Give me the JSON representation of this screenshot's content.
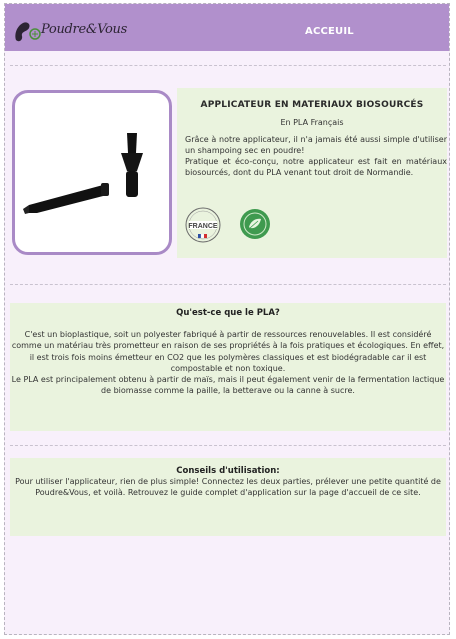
{
  "header": {
    "logo_text": "Poudre&Vous",
    "nav_link": "ACCEUIL",
    "colors": {
      "bar": "#b190cc",
      "text": "#ffffff"
    }
  },
  "product": {
    "title": "APPLICATEUR EN MATERIAUX BIOSOURCÉS",
    "subtitle": "En PLA Français",
    "desc1": "Grâce à notre applicateur, il n'a jamais été aussi simple d'utiliser un shampoing sec en poudre!",
    "desc2": "Pratique et éco-conçu, notre applicateur est fait en matériaux biosourcés, dont du PLA venant tout droit de Normandie.",
    "badge_france": "FRANCE",
    "image_icon": "applicator-photo"
  },
  "pla": {
    "title": "Qu'est-ce que le PLA?",
    "para1": "C'est un bioplastique, soit un polyester fabriqué à partir de ressources renouvelables. Il est considéré comme un matériau très prometteur en raison de ses propriétés à la fois pratiques et écologiques. En effet, il est trois fois moins émetteur en CO2 que les polymères classiques et est biodégradable car il est compostable et non toxique.",
    "para2": "Le PLA est principalement obtenu à partir de maïs, mais il peut également venir de la fermentation lactique de biomasse comme la paille, la betterave ou la canne à sucre."
  },
  "tips": {
    "title": "Conseils d'utilisation:",
    "text": "Pour utiliser l'applicateur, rien de plus simple! Connectez les deux parties, prélever une petite quantité de Poudre&Vous, et voilà. Retrouvez le guide complet d'application sur la page d'accueil de ce site."
  },
  "colors": {
    "accent": "#a98ac6",
    "panel": "#eaf3de",
    "page": "#f8f0fb"
  }
}
